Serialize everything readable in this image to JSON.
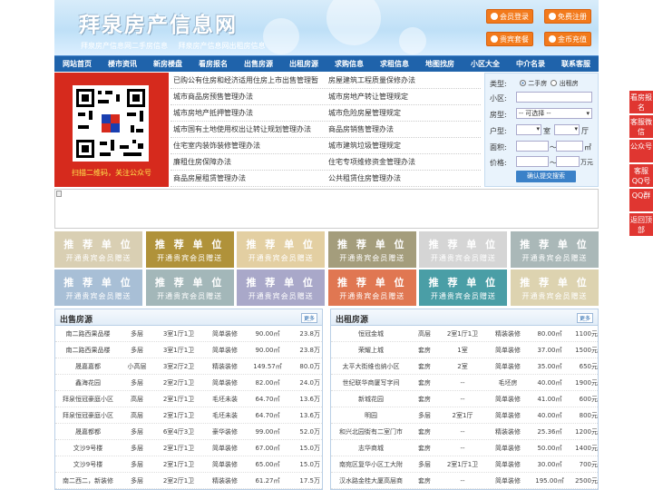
{
  "site": {
    "title": "拜泉房产信息网",
    "subtitles": [
      "拜泉房产信息网二手房信息",
      "拜泉房产信息网出租房信息"
    ]
  },
  "header_buttons": [
    "会员登录",
    "免费注册",
    "贵宾套餐",
    "金币充值"
  ],
  "nav": [
    "网站首页",
    "楼市资讯",
    "新房楼盘",
    "看房报名",
    "出售房源",
    "出租房源",
    "求购信息",
    "求租信息",
    "地图找房",
    "小区大全",
    "中介名录",
    "联系客服"
  ],
  "qr": {
    "caption": "扫描二维码，关注公众号"
  },
  "links": [
    [
      "已购公有住房和经济适用住房上市出售管理暂",
      "房屋建筑工程质量保修办法"
    ],
    [
      "城市商品房预售管理办法",
      "城市房地产转让管理规定"
    ],
    [
      "城市房地产抵押管理办法",
      "城市危险房屋管理规定"
    ],
    [
      "城市国有土地使用权出让转让规划管理办法",
      "商品房销售管理办法"
    ],
    [
      "住宅室内装饰装修管理办法",
      "城市建筑垃圾管理规定"
    ],
    [
      "廉租住房保障办法",
      "住宅专项维修资金管理办法"
    ],
    [
      "商品房屋租赁管理办法",
      "公共租赁住房管理办法"
    ]
  ],
  "search": {
    "type_label": "类型:",
    "type_opt1": "二手房",
    "type_opt2": "出租房",
    "community_label": "小区:",
    "housetype_label": "房型:",
    "housetype_value": "-- 可选择 --",
    "layout_label": "户型:",
    "room_unit": "室",
    "hall_unit": "厅",
    "area_label": "面积:",
    "area_sep": "～",
    "area_unit": "㎡",
    "price_label": "价格:",
    "price_sep": "～",
    "price_unit": "万元",
    "submit": "确认提交搜索"
  },
  "ads": {
    "line1": "推 荐 单 位",
    "line2": "开通贵宾会员赠送",
    "colors": [
      "#d9cfb3",
      "#b0923a",
      "#e3cfa2",
      "#a49d7c",
      "#d5d5d5",
      "#aab8b8",
      "#a8bfd6",
      "#a3b7b9",
      "#a9a8c9",
      "#e07752",
      "#4a9ea6",
      "#ddd3b0"
    ]
  },
  "sale": {
    "title": "出售房源",
    "more": "更多",
    "rows": [
      [
        "南二路西果品楼",
        "多层",
        "3室1厅1卫",
        "简单装修",
        "90.00㎡",
        "23.8万"
      ],
      [
        "南二路西果品楼",
        "多层",
        "3室1厅1卫",
        "简单装修",
        "90.00㎡",
        "23.8万"
      ],
      [
        "晟嘉嘉都",
        "小高层",
        "3室2厅2卫",
        "精装装修",
        "149.57㎡",
        "80.0万"
      ],
      [
        "鑫海花园",
        "多层",
        "2室2厅1卫",
        "简单装修",
        "82.00㎡",
        "24.0万"
      ],
      [
        "拜泉恒冠豪庭小区",
        "高层",
        "2室1厅1卫",
        "毛坯未装",
        "64.70㎡",
        "13.6万"
      ],
      [
        "拜泉恒冠豪庭小区",
        "高层",
        "2室1厅1卫",
        "毛坯未装",
        "64.70㎡",
        "13.6万"
      ],
      [
        "晟嘉都都",
        "多层",
        "6室4厅3卫",
        "豪华装修",
        "99.00㎡",
        "52.0万"
      ],
      [
        "文沙9号楼",
        "多层",
        "2室1厅1卫",
        "简单装修",
        "67.00㎡",
        "15.0万"
      ],
      [
        "文沙9号楼",
        "多层",
        "2室1厅1卫",
        "简单装修",
        "65.00㎡",
        "15.0万"
      ],
      [
        "南二西二，新装修",
        "多层",
        "2室2厅1卫",
        "精装装修",
        "61.27㎡",
        "17.5万"
      ]
    ]
  },
  "rent": {
    "title": "出租房源",
    "more": "更多",
    "rows": [
      [
        "恒冠金城",
        "高层",
        "2室1厅1卫",
        "精装装修",
        "80.00㎡",
        "1100元"
      ],
      [
        "荣耀上城",
        "套房",
        "1室",
        "简单装修",
        "37.00㎡",
        "1500元"
      ],
      [
        "太平大街维也纳小区",
        "套房",
        "2室",
        "简单装修",
        "35.00㎡",
        "650元"
      ],
      [
        "世纪联华商厦写字间",
        "套房",
        "--",
        "毛坯房",
        "40.00㎡",
        "1900元"
      ],
      [
        "新城花园",
        "套房",
        "--",
        "简单装修",
        "41.00㎡",
        "600元"
      ],
      [
        "明园",
        "多层",
        "2室1厅",
        "简单装修",
        "40.00㎡",
        "800元"
      ],
      [
        "和兴北园街有二室门市",
        "套房",
        "--",
        "精装装修",
        "25.36㎡",
        "1200元"
      ],
      [
        "志华商城",
        "套房",
        "--",
        "简单装修",
        "50.00㎡",
        "1400元"
      ],
      [
        "南宛区复华小区工大附",
        "多层",
        "2室1厅1卫",
        "简单装修",
        "30.00㎡",
        "700元"
      ],
      [
        "汉水路金桂大厦高层商",
        "套房",
        "--",
        "简单装修",
        "195.00㎡",
        "2500元"
      ]
    ]
  },
  "sidebar": [
    "看房报名",
    "客服微信",
    "公众号",
    "客服QQ号",
    "QQ群",
    "返回顶部"
  ]
}
